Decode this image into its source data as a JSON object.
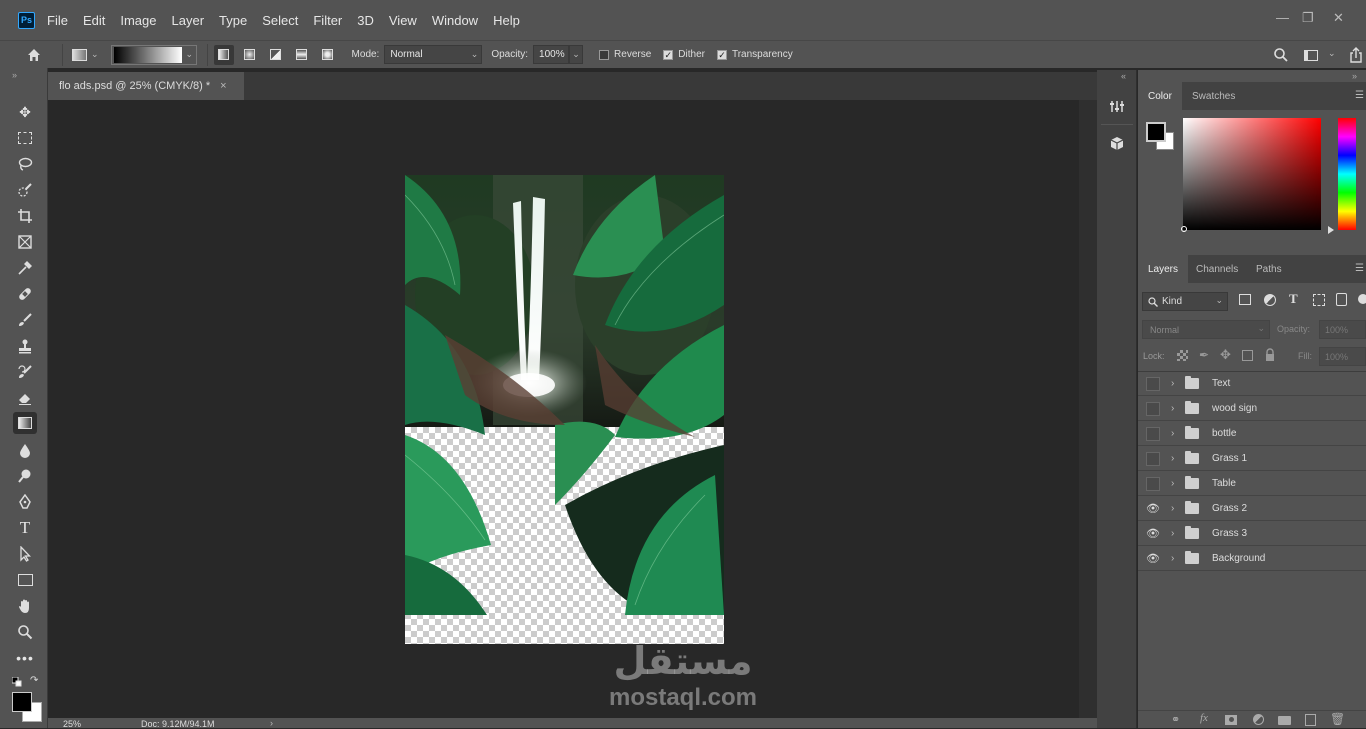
{
  "menubar": {
    "logo": "Ps",
    "items": [
      "File",
      "Edit",
      "Image",
      "Layer",
      "Type",
      "Select",
      "Filter",
      "3D",
      "View",
      "Window",
      "Help"
    ]
  },
  "options": {
    "mode_label": "Mode:",
    "mode_value": "Normal",
    "opacity_label": "Opacity:",
    "opacity_value": "100%",
    "reverse_label": "Reverse",
    "reverse_checked": false,
    "dither_label": "Dither",
    "dither_checked": true,
    "transparency_label": "Transparency",
    "transparency_checked": true
  },
  "document": {
    "tab_title": "flo ads.psd @ 25% (CMYK/8) *",
    "close_glyph": "×"
  },
  "status": {
    "zoom": "25%",
    "doc_info": "Doc: 9.12M/94.1M"
  },
  "color_panel": {
    "tabs": [
      "Color",
      "Swatches"
    ],
    "foreground": "#000000",
    "background": "#ffffff",
    "hue": "#ff0000"
  },
  "layers_panel": {
    "tabs": [
      "Layers",
      "Channels",
      "Paths"
    ],
    "filter_label": "Kind",
    "blend_mode": "Normal",
    "opacity_label": "Opacity:",
    "opacity_value": "100%",
    "lock_label": "Lock:",
    "fill_label": "Fill:",
    "fill_value": "100%",
    "layers": [
      {
        "name": "Text",
        "visible": false
      },
      {
        "name": "wood sign",
        "visible": false
      },
      {
        "name": "bottle",
        "visible": false
      },
      {
        "name": "Grass 1",
        "visible": false
      },
      {
        "name": "Table",
        "visible": false
      },
      {
        "name": "Grass 2",
        "visible": true
      },
      {
        "name": "Grass 3",
        "visible": true
      },
      {
        "name": "Background",
        "visible": true
      }
    ]
  },
  "watermark": {
    "arabic": "مستقل",
    "latin": "mostaql.com"
  }
}
